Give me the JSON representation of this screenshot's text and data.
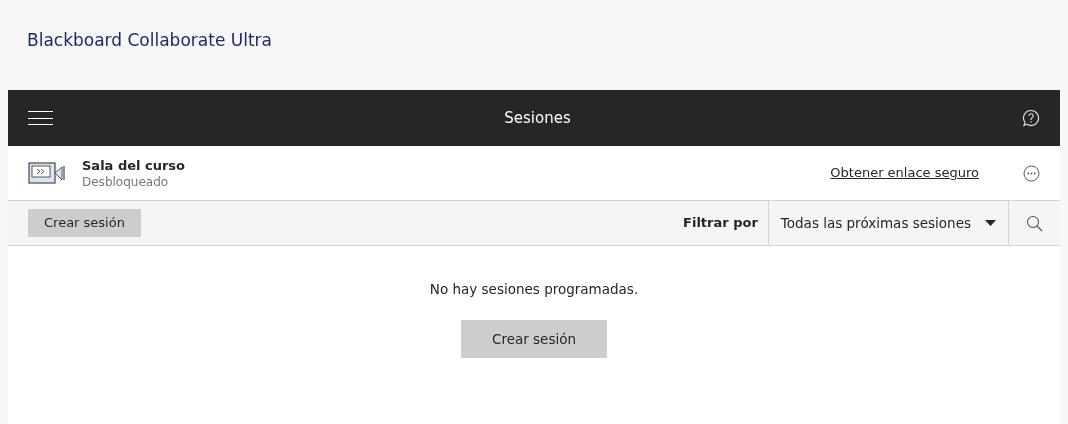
{
  "app_title": "Blackboard Collaborate Ultra",
  "header": {
    "title": "Sesiones"
  },
  "room": {
    "name": "Sala del curso",
    "status": "Desbloqueado",
    "link": "Obtener enlace seguro"
  },
  "toolbar": {
    "create_button": "Crear sesión",
    "filter_label": "Filtrar por",
    "filter_value": "Todas las próximas sesiones"
  },
  "empty_state": {
    "message": "No hay sesiones programadas.",
    "button": "Crear sesión"
  }
}
